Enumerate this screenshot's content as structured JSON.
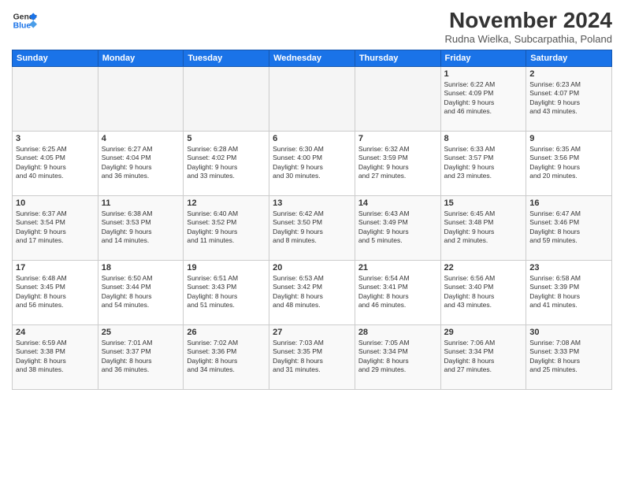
{
  "header": {
    "logo_line1": "General",
    "logo_line2": "Blue",
    "month": "November 2024",
    "location": "Rudna Wielka, Subcarpathia, Poland"
  },
  "days_of_week": [
    "Sunday",
    "Monday",
    "Tuesday",
    "Wednesday",
    "Thursday",
    "Friday",
    "Saturday"
  ],
  "weeks": [
    [
      {
        "num": "",
        "info": ""
      },
      {
        "num": "",
        "info": ""
      },
      {
        "num": "",
        "info": ""
      },
      {
        "num": "",
        "info": ""
      },
      {
        "num": "",
        "info": ""
      },
      {
        "num": "1",
        "info": "Sunrise: 6:22 AM\nSunset: 4:09 PM\nDaylight: 9 hours\nand 46 minutes."
      },
      {
        "num": "2",
        "info": "Sunrise: 6:23 AM\nSunset: 4:07 PM\nDaylight: 9 hours\nand 43 minutes."
      }
    ],
    [
      {
        "num": "3",
        "info": "Sunrise: 6:25 AM\nSunset: 4:05 PM\nDaylight: 9 hours\nand 40 minutes."
      },
      {
        "num": "4",
        "info": "Sunrise: 6:27 AM\nSunset: 4:04 PM\nDaylight: 9 hours\nand 36 minutes."
      },
      {
        "num": "5",
        "info": "Sunrise: 6:28 AM\nSunset: 4:02 PM\nDaylight: 9 hours\nand 33 minutes."
      },
      {
        "num": "6",
        "info": "Sunrise: 6:30 AM\nSunset: 4:00 PM\nDaylight: 9 hours\nand 30 minutes."
      },
      {
        "num": "7",
        "info": "Sunrise: 6:32 AM\nSunset: 3:59 PM\nDaylight: 9 hours\nand 27 minutes."
      },
      {
        "num": "8",
        "info": "Sunrise: 6:33 AM\nSunset: 3:57 PM\nDaylight: 9 hours\nand 23 minutes."
      },
      {
        "num": "9",
        "info": "Sunrise: 6:35 AM\nSunset: 3:56 PM\nDaylight: 9 hours\nand 20 minutes."
      }
    ],
    [
      {
        "num": "10",
        "info": "Sunrise: 6:37 AM\nSunset: 3:54 PM\nDaylight: 9 hours\nand 17 minutes."
      },
      {
        "num": "11",
        "info": "Sunrise: 6:38 AM\nSunset: 3:53 PM\nDaylight: 9 hours\nand 14 minutes."
      },
      {
        "num": "12",
        "info": "Sunrise: 6:40 AM\nSunset: 3:52 PM\nDaylight: 9 hours\nand 11 minutes."
      },
      {
        "num": "13",
        "info": "Sunrise: 6:42 AM\nSunset: 3:50 PM\nDaylight: 9 hours\nand 8 minutes."
      },
      {
        "num": "14",
        "info": "Sunrise: 6:43 AM\nSunset: 3:49 PM\nDaylight: 9 hours\nand 5 minutes."
      },
      {
        "num": "15",
        "info": "Sunrise: 6:45 AM\nSunset: 3:48 PM\nDaylight: 9 hours\nand 2 minutes."
      },
      {
        "num": "16",
        "info": "Sunrise: 6:47 AM\nSunset: 3:46 PM\nDaylight: 8 hours\nand 59 minutes."
      }
    ],
    [
      {
        "num": "17",
        "info": "Sunrise: 6:48 AM\nSunset: 3:45 PM\nDaylight: 8 hours\nand 56 minutes."
      },
      {
        "num": "18",
        "info": "Sunrise: 6:50 AM\nSunset: 3:44 PM\nDaylight: 8 hours\nand 54 minutes."
      },
      {
        "num": "19",
        "info": "Sunrise: 6:51 AM\nSunset: 3:43 PM\nDaylight: 8 hours\nand 51 minutes."
      },
      {
        "num": "20",
        "info": "Sunrise: 6:53 AM\nSunset: 3:42 PM\nDaylight: 8 hours\nand 48 minutes."
      },
      {
        "num": "21",
        "info": "Sunrise: 6:54 AM\nSunset: 3:41 PM\nDaylight: 8 hours\nand 46 minutes."
      },
      {
        "num": "22",
        "info": "Sunrise: 6:56 AM\nSunset: 3:40 PM\nDaylight: 8 hours\nand 43 minutes."
      },
      {
        "num": "23",
        "info": "Sunrise: 6:58 AM\nSunset: 3:39 PM\nDaylight: 8 hours\nand 41 minutes."
      }
    ],
    [
      {
        "num": "24",
        "info": "Sunrise: 6:59 AM\nSunset: 3:38 PM\nDaylight: 8 hours\nand 38 minutes."
      },
      {
        "num": "25",
        "info": "Sunrise: 7:01 AM\nSunset: 3:37 PM\nDaylight: 8 hours\nand 36 minutes."
      },
      {
        "num": "26",
        "info": "Sunrise: 7:02 AM\nSunset: 3:36 PM\nDaylight: 8 hours\nand 34 minutes."
      },
      {
        "num": "27",
        "info": "Sunrise: 7:03 AM\nSunset: 3:35 PM\nDaylight: 8 hours\nand 31 minutes."
      },
      {
        "num": "28",
        "info": "Sunrise: 7:05 AM\nSunset: 3:34 PM\nDaylight: 8 hours\nand 29 minutes."
      },
      {
        "num": "29",
        "info": "Sunrise: 7:06 AM\nSunset: 3:34 PM\nDaylight: 8 hours\nand 27 minutes."
      },
      {
        "num": "30",
        "info": "Sunrise: 7:08 AM\nSunset: 3:33 PM\nDaylight: 8 hours\nand 25 minutes."
      }
    ]
  ]
}
